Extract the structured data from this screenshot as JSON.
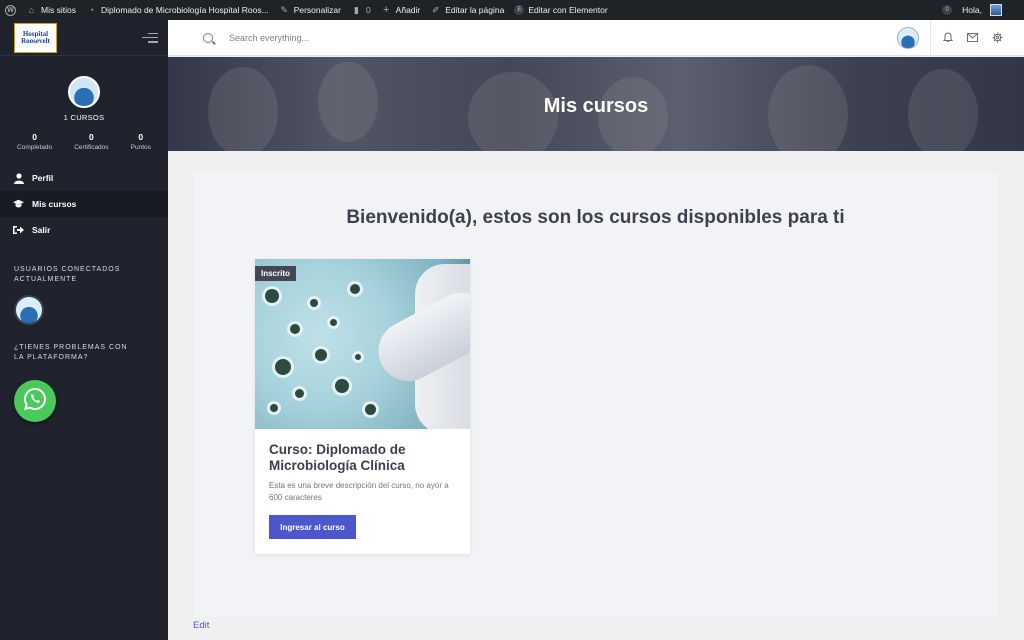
{
  "adminbar": {
    "items": [
      {
        "icon": "wordpress-icon",
        "label": ""
      },
      {
        "icon": "sites-icon",
        "label": "Mis sitios"
      },
      {
        "icon": "dashboard-icon",
        "label": "Diplomado de Microbiología Hospital Roos..."
      },
      {
        "icon": "brush-icon",
        "label": "Personalizar"
      },
      {
        "icon": "comment-icon",
        "label": "0"
      },
      {
        "icon": "plus-icon",
        "label": "Añadir"
      },
      {
        "icon": "pencil-icon",
        "label": "Editar la página"
      },
      {
        "icon": "elementor-icon",
        "label": "Editar con Elementor"
      }
    ],
    "notification_count": "0",
    "greeting": "Hola,"
  },
  "sidebar": {
    "logo_lines": [
      "Hospital",
      "Roosevelt"
    ],
    "course_count": "1 CURSOS",
    "stats": [
      {
        "value": "0",
        "label": "Completado"
      },
      {
        "value": "0",
        "label": "Certificados"
      },
      {
        "value": "0",
        "label": "Puntos"
      }
    ],
    "menu": [
      {
        "icon": "user-icon",
        "label": "Perfil"
      },
      {
        "icon": "graduation-cap-icon",
        "label": "Mis cursos"
      },
      {
        "icon": "sign-out-icon",
        "label": "Salir"
      }
    ],
    "online_title": "USUARIOS CONECTADOS ACTUALMENTE",
    "help_title": "¿TIENES PROBLEMAS CON LA PLATAFORMA?"
  },
  "topbar": {
    "search_placeholder": "Search everything..."
  },
  "hero": {
    "title": "Mis cursos"
  },
  "main": {
    "welcome": "Bienvenido(a), estos son los cursos disponibles para ti",
    "courses": [
      {
        "badge": "Inscrito",
        "title": "Curso: Diplomado de Microbiología Clínica",
        "description": "Esta es una breve descripción del curso, no ayor a 600 caracteres",
        "button": "Ingresar al curso"
      }
    ]
  },
  "footer": {
    "edit_link": "Edit"
  },
  "colors": {
    "accent": "#4d57cc",
    "sidebar": "#20222e",
    "whatsapp": "#4bc85a"
  }
}
